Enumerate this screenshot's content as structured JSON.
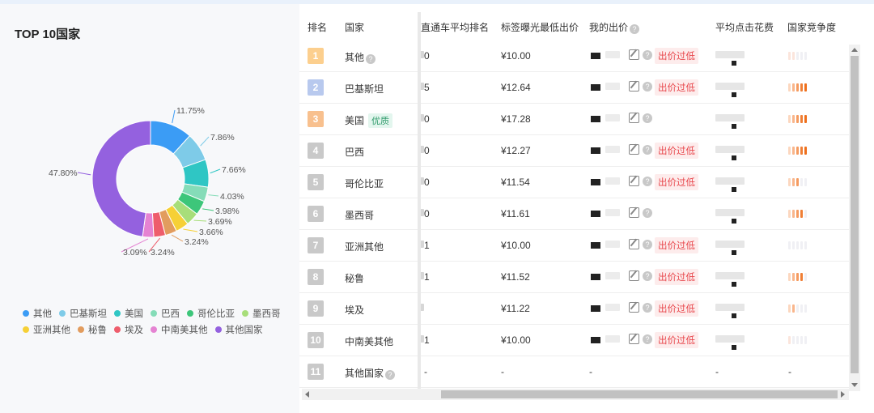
{
  "left": {
    "title": "TOP 10国家",
    "segments": [
      {
        "name": "其他",
        "pct": 11.75,
        "label": "11.75%",
        "color": "#3b9cf5"
      },
      {
        "name": "巴基斯坦",
        "pct": 7.86,
        "label": "7.86%",
        "color": "#7ecbe8"
      },
      {
        "name": "美国",
        "pct": 7.66,
        "label": "7.66%",
        "color": "#2fc6c4"
      },
      {
        "name": "巴西",
        "pct": 4.03,
        "label": "4.03%",
        "color": "#85dcb8"
      },
      {
        "name": "哥伦比亚",
        "pct": 3.98,
        "label": "3.98%",
        "color": "#3dc67a"
      },
      {
        "name": "墨西哥",
        "pct": 3.69,
        "label": "3.69%",
        "color": "#a8de7a"
      },
      {
        "name": "亚洲其他",
        "pct": 3.66,
        "label": "3.66%",
        "color": "#f6d036"
      },
      {
        "name": "秘鲁",
        "pct": 3.24,
        "label": "3.24%",
        "color": "#e29c5e"
      },
      {
        "name": "埃及",
        "pct": 3.24,
        "label": "3.24%",
        "color": "#ee5d6c"
      },
      {
        "name": "中南美其他",
        "pct": 3.09,
        "label": "3.09%",
        "color": "#e583d2"
      },
      {
        "name": "其他国家",
        "pct": 47.8,
        "label": "47.80%",
        "color": "#9461df"
      }
    ]
  },
  "table": {
    "headers": {
      "rank": "排名",
      "country": "国家",
      "avg_rank": "直通车平均排名",
      "min_bid": "标签曝光最低出价",
      "my_bid": "我的出价",
      "avg_cpc": "平均点击花费",
      "competition": "国家竞争度"
    },
    "help_glyph": "?",
    "good_tag": "优质",
    "low_tag": "出价过低",
    "rows": [
      {
        "rank": "1",
        "country": "其他",
        "help": "?",
        "avg_rank": "0",
        "min_bid": "¥10.00",
        "low": true,
        "bars": [
          "#fbe5dc",
          "#fbe5dc",
          "#f0f0f4",
          "#f0f0f4",
          "#f0f0f4"
        ]
      },
      {
        "rank": "2",
        "country": "巴基斯坦",
        "avg_rank": "5",
        "min_bid": "¥12.64",
        "low": true,
        "bars": [
          "#fcd7bf",
          "#f9b68c",
          "#f59b60",
          "#f07f35",
          "#ee6f1c"
        ]
      },
      {
        "rank": "3",
        "country": "美国",
        "good": true,
        "avg_rank": "0",
        "min_bid": "¥17.28",
        "low": false,
        "bars": [
          "#fcd7bf",
          "#f9b68c",
          "#f59b60",
          "#f07f35",
          "#ee6f1c"
        ]
      },
      {
        "rank": "4",
        "country": "巴西",
        "avg_rank": "0",
        "min_bid": "¥12.27",
        "low": true,
        "bars": [
          "#fcd7bf",
          "#f9b68c",
          "#f59b60",
          "#f07f35",
          "#ee6f1c"
        ]
      },
      {
        "rank": "5",
        "country": "哥伦比亚",
        "avg_rank": "0",
        "min_bid": "¥11.54",
        "low": true,
        "bars": [
          "#fcd7bf",
          "#f9b68c",
          "#f59b60",
          "#f0f0f4",
          "#f0f0f4"
        ]
      },
      {
        "rank": "6",
        "country": "墨西哥",
        "avg_rank": "0",
        "min_bid": "¥11.61",
        "low": false,
        "bars": [
          "#fcd7bf",
          "#f9b68c",
          "#f59b60",
          "#f07f35",
          "#f0f0f4"
        ]
      },
      {
        "rank": "7",
        "country": "亚洲其他",
        "avg_rank": "1",
        "min_bid": "¥10.00",
        "low": true,
        "bars": [
          "#f0f0f4",
          "#f0f0f4",
          "#f0f0f4",
          "#f0f0f4",
          "#f0f0f4"
        ]
      },
      {
        "rank": "8",
        "country": "秘鲁",
        "avg_rank": "1",
        "min_bid": "¥11.52",
        "low": true,
        "bars": [
          "#fcd7bf",
          "#f9b68c",
          "#f59b60",
          "#f07f35",
          "#f0f0f4"
        ]
      },
      {
        "rank": "9",
        "country": "埃及",
        "avg_rank": "",
        "min_bid": "¥11.22",
        "low": true,
        "bars": [
          "#fcd7bf",
          "#f9b68c",
          "#f0f0f4",
          "#f0f0f4",
          "#f0f0f4"
        ]
      },
      {
        "rank": "10",
        "country": "中南美其他",
        "avg_rank": "1",
        "min_bid": "¥10.00",
        "low": true,
        "bars": [
          "#fbe5dc",
          "#f0f0f4",
          "#f0f0f4",
          "#f0f0f4",
          "#f0f0f4"
        ]
      },
      {
        "rank": "11",
        "country": "其他国家",
        "help": "?",
        "avg_rank": "-",
        "min_bid": "-",
        "my_bid": "-",
        "avg_cpc": "-",
        "competition": "-",
        "empty": true
      }
    ],
    "badge_colors": [
      "#fccf8e",
      "#b8c9ee",
      "#f8c08e",
      "#c9c9c9"
    ]
  }
}
